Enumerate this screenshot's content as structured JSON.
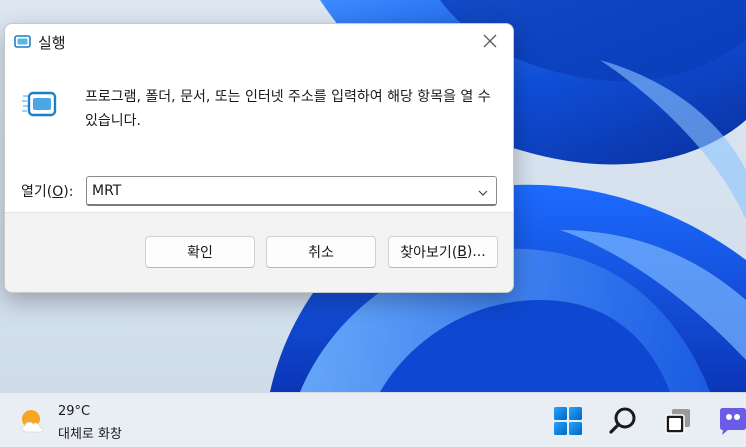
{
  "dialog": {
    "title": "실행",
    "description": "프로그램, 폴더, 문서, 또는 인터넷 주소를 입력하여 해당 항목을 열 수 있습니다.",
    "open_label_prefix": "열기(",
    "open_label_key": "O",
    "open_label_suffix": "):",
    "input_value": "MRT",
    "buttons": {
      "ok": "확인",
      "cancel": "취소",
      "browse_prefix": "찾아보기(",
      "browse_key": "B",
      "browse_suffix": ")..."
    },
    "icons": {
      "title": "run-icon",
      "close": "close-icon",
      "dropdown": "chevron-down-icon"
    }
  },
  "taskbar": {
    "weather": {
      "temperature": "29°C",
      "condition": "대체로 화창",
      "icon": "sun-cloud-icon"
    },
    "icons": [
      "windows-start-icon",
      "search-icon",
      "task-view-icon",
      "chat-icon"
    ]
  },
  "colors": {
    "accent": "#0067c0",
    "wallpaper_blue": "#1a5fe0",
    "dialog_footer": "#f3f3f3"
  }
}
